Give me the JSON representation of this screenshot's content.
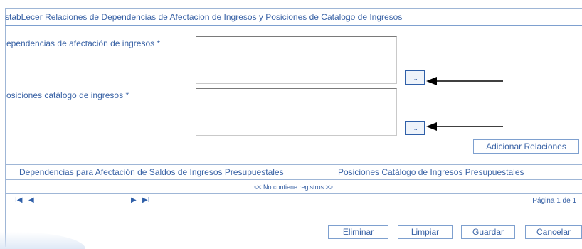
{
  "form": {
    "title": "stabLecer Relaciones de Dependencias de Afectacion de Ingresos y Posiciones de Catalogo de Ingresos",
    "dependencias_label": "ependencias de afectación de ingresos *",
    "posiciones_label": "osiciones catálogo de ingresos *",
    "dependencias_value": "",
    "posiciones_value": "",
    "lookup_label": "...",
    "add_button": "Adicionar Relaciones"
  },
  "grid": {
    "columns": [
      "Dependencias para Afectación de Saldos de Ingresos Presupuestales",
      "Posiciones Catálogo de Ingresos Presupuestales"
    ],
    "empty_message": "<< No contiene registros >>"
  },
  "pager": {
    "first": "I◀",
    "prev": "◀",
    "next": "▶",
    "last": "▶I",
    "page_info": "Página 1 de 1"
  },
  "actions": {
    "eliminar": "Eliminar",
    "limpiar": "Limpiar",
    "guardar": "Guardar",
    "cancelar": "Cancelar"
  },
  "icons": [
    "arrow-left-icon",
    "first-page-icon",
    "prev-page-icon",
    "next-page-icon",
    "last-page-icon"
  ],
  "colors": {
    "text": "#3a63a6",
    "border": "#7ea0cf",
    "button_border": "#2f5fa8"
  }
}
